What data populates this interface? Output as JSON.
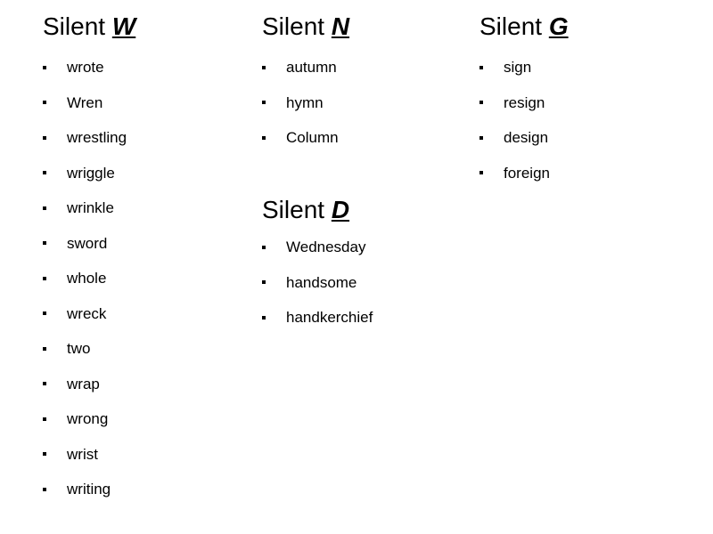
{
  "slide": {
    "background_color": "#ffffff",
    "text_color": "#000000",
    "columns": [
      {
        "sections": [
          {
            "heading_prefix": "Silent ",
            "heading_letter": "W",
            "items": [
              "wrote",
              "Wren",
              "wrestling",
              "wriggle",
              "wrinkle",
              "sword",
              "whole",
              "wreck",
              "two",
              "wrap",
              "wrong",
              "wrist",
              "writing"
            ]
          }
        ]
      },
      {
        "sections": [
          {
            "heading_prefix": "Silent ",
            "heading_letter": "N",
            "items": [
              "autumn",
              "hymn",
              "Column"
            ]
          },
          {
            "heading_prefix": "Silent ",
            "heading_letter": "D",
            "items": [
              "Wednesday",
              "handsome",
              "handkerchief"
            ]
          }
        ]
      },
      {
        "sections": [
          {
            "heading_prefix": "Silent ",
            "heading_letter": "G",
            "items": [
              "sign",
              "resign",
              "design",
              "foreign"
            ]
          }
        ]
      }
    ]
  }
}
